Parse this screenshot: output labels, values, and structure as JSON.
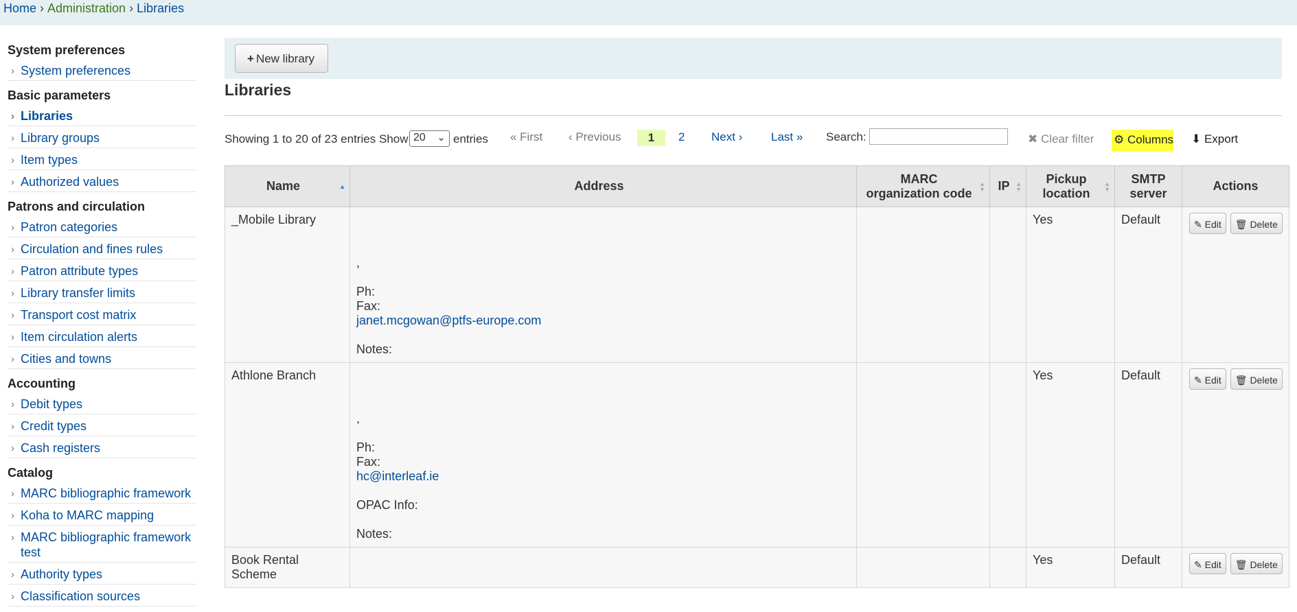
{
  "breadcrumb": {
    "home": "Home",
    "admin": "Administration",
    "current": "Libraries",
    "sep": "›"
  },
  "sidebar": {
    "sections": [
      {
        "title": "System preferences",
        "items": [
          "System preferences"
        ]
      },
      {
        "title": "Basic parameters",
        "items": [
          "Libraries",
          "Library groups",
          "Item types",
          "Authorized values"
        ]
      },
      {
        "title": "Patrons and circulation",
        "items": [
          "Patron categories",
          "Circulation and fines rules",
          "Patron attribute types",
          "Library transfer limits",
          "Transport cost matrix",
          "Item circulation alerts",
          "Cities and towns"
        ]
      },
      {
        "title": "Accounting",
        "items": [
          "Debit types",
          "Credit types",
          "Cash registers"
        ]
      },
      {
        "title": "Catalog",
        "items": [
          "MARC bibliographic framework",
          "Koha to MARC mapping",
          "MARC bibliographic framework test",
          "Authority types",
          "Classification sources"
        ]
      }
    ],
    "active": "Libraries"
  },
  "toolbar": {
    "new_library": "New library",
    "plus": "+"
  },
  "page_title": "Libraries",
  "table_controls": {
    "info": "Showing 1 to 20 of 23 entries",
    "show": "Show",
    "page_size": "20",
    "entries": "entries",
    "first": "« First",
    "previous": "‹ Previous",
    "page1": "1",
    "page2": "2",
    "next": "Next ›",
    "last": "Last »",
    "search_label": "Search:",
    "search_value": "",
    "clear_filter": "✖ Clear filter",
    "columns": "⚙ Columns",
    "export": "⬇ Export"
  },
  "table": {
    "headers": {
      "name": "Name",
      "address": "Address",
      "marc1": "MARC",
      "marc2": "organization code",
      "ip": "IP",
      "pickup1": "Pickup",
      "pickup2": "location",
      "smtp1": "SMTP",
      "smtp2": "server",
      "actions": "Actions"
    },
    "rows": [
      {
        "name": "_Mobile Library",
        "address": [
          "",
          "",
          "",
          ",",
          "",
          "Ph:",
          "Fax:",
          "janet.mcgowan@ptfs-europe.com",
          "",
          "Notes:"
        ],
        "email_index": 7,
        "marc": "",
        "ip": "",
        "pickup": "Yes",
        "smtp": "Default",
        "edit": "Edit",
        "delete": "Delete"
      },
      {
        "name": "Athlone Branch",
        "address": [
          "",
          "",
          "",
          ",",
          "",
          "Ph:",
          "Fax:",
          "hc@interleaf.ie",
          "",
          "OPAC Info:",
          "",
          "Notes:"
        ],
        "email_index": 7,
        "marc": "",
        "ip": "",
        "pickup": "Yes",
        "smtp": "Default",
        "edit": "Edit",
        "delete": "Delete"
      },
      {
        "name": "Book Rental Scheme",
        "address": [],
        "email_index": -1,
        "marc": "",
        "ip": "",
        "pickup": "Yes",
        "smtp": "Default",
        "edit": "Edit",
        "delete": "Delete"
      }
    ]
  }
}
